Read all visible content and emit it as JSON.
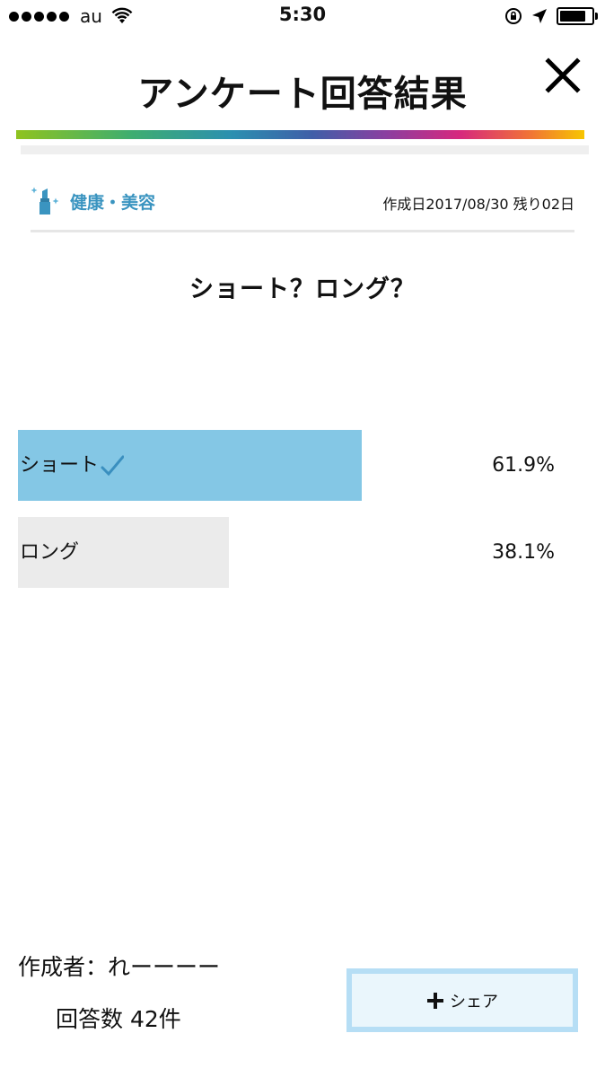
{
  "status_bar": {
    "carrier": "au",
    "time": "5:30",
    "signal_bars": 5
  },
  "header": {
    "title": "アンケート回答結果",
    "close_icon": "close-icon"
  },
  "survey": {
    "category": "健康・美容",
    "category_icon": "lipstick-icon",
    "meta": "作成日2017/08/30 残り02日",
    "question": "ショート？ロング？",
    "results": [
      {
        "label": "ショート",
        "percent_text": "61.9%",
        "percent": 61.9,
        "selected": true
      },
      {
        "label": "ロング",
        "percent_text": "38.1%",
        "percent": 38.1,
        "selected": false
      }
    ]
  },
  "footer": {
    "author": "作成者：れーーーー",
    "answer_count": "回答数 42件",
    "share_label": "シェア",
    "share_icon": "plus-icon"
  },
  "colors": {
    "selected_bar": "#84c7e5",
    "unselected_bar": "#ebebeb",
    "category": "#3a94c0",
    "share_border": "#b6def5"
  }
}
